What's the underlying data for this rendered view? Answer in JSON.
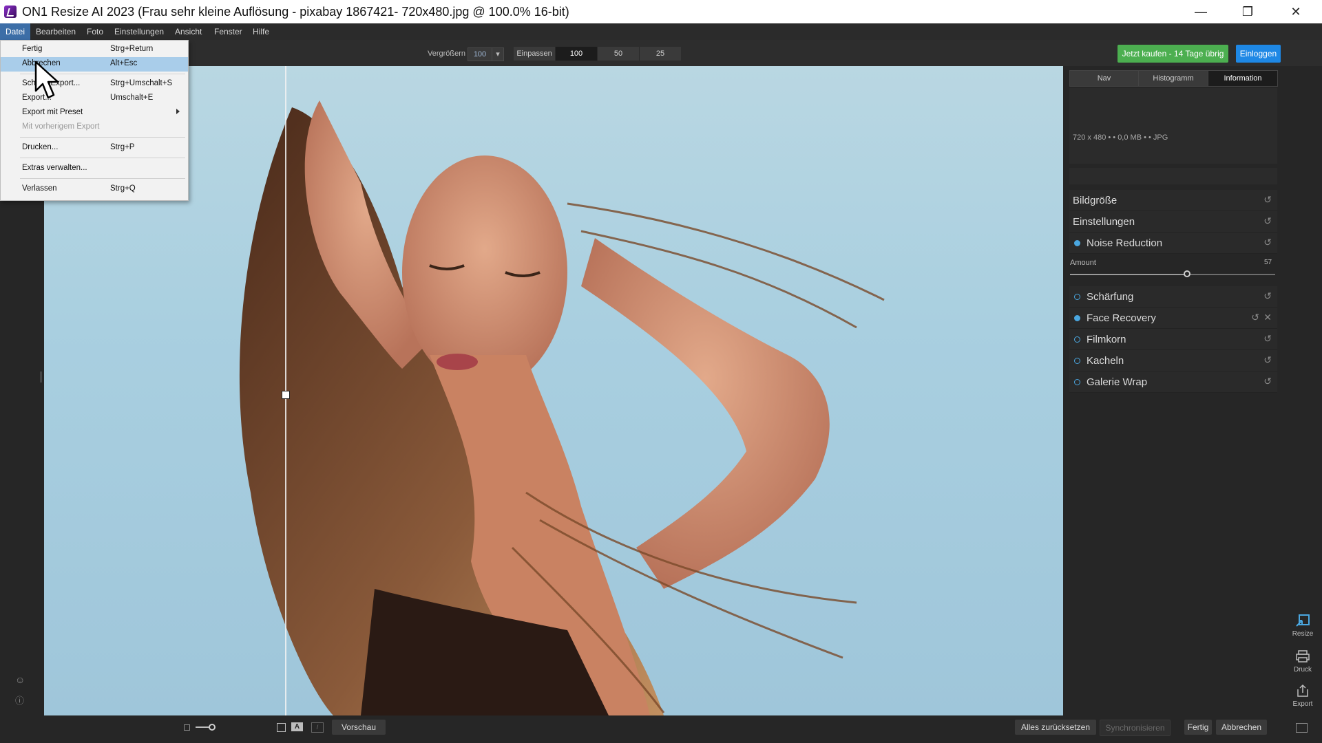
{
  "window": {
    "title": "ON1 Resize AI 2023 (Frau sehr kleine Auflösung - pixabay 1867421- 720x480.jpg @ 100.0% 16-bit)",
    "minimize_icon": "minimize-icon",
    "restore_icon": "restore-icon",
    "close_icon": "close-icon"
  },
  "menubar": {
    "items": [
      "Datei",
      "Bearbeiten",
      "Foto",
      "Einstellungen",
      "Ansicht",
      "Fenster",
      "Hilfe"
    ]
  },
  "file_menu": {
    "items": [
      {
        "label": "Fertig",
        "shortcut": "Strg+Return"
      },
      {
        "label": "Abbrechen",
        "shortcut": "Alt+Esc",
        "highlighted": true
      },
      {
        "label": "Schnell-Export...",
        "shortcut": "Strg+Umschalt+S"
      },
      {
        "label": "Export...",
        "shortcut": "Umschalt+E"
      },
      {
        "label": "Export mit Preset",
        "shortcut": "",
        "submenu": true
      },
      {
        "label": "Mit vorherigem Export",
        "shortcut": "",
        "disabled": true
      },
      {
        "label": "Drucken...",
        "shortcut": "Strg+P"
      },
      {
        "label": "Extras verwalten...",
        "shortcut": ""
      },
      {
        "label": "Verlassen",
        "shortcut": "Strg+Q"
      }
    ]
  },
  "toolbar": {
    "zoom_label": "Vergrößern",
    "zoom_value": "100",
    "fit_label": "Einpassen",
    "zoom_presets": [
      "100",
      "50",
      "25"
    ],
    "buy_button": "Jetzt kaufen - 14 Tage übrig",
    "login_button": "Einloggen",
    "colors": {
      "buy": "#4caf50",
      "login": "#1e88e5"
    }
  },
  "right_panel": {
    "tabs": [
      "Nav",
      "Histogramm",
      "Information"
    ],
    "active_tab": "Information",
    "info": "720 x 480 • • 0,0 MB • • JPG",
    "sections": [
      {
        "label": "Bildgröße",
        "dot": "none"
      },
      {
        "label": "Einstellungen",
        "dot": "none"
      },
      {
        "label": "Noise Reduction",
        "dot": "on"
      }
    ],
    "amount_label": "Amount",
    "amount_value": "57",
    "amount_fraction": 0.57,
    "sections2": [
      {
        "label": "Schärfung",
        "dot": "off"
      },
      {
        "label": "Face Recovery",
        "dot": "on",
        "closable": true
      },
      {
        "label": "Filmkorn",
        "dot": "off"
      },
      {
        "label": "Kacheln",
        "dot": "off"
      },
      {
        "label": "Galerie Wrap",
        "dot": "off"
      }
    ],
    "accent": "#4aa7e0"
  },
  "modules": [
    {
      "label": "Resize",
      "icon": "resize-icon"
    },
    {
      "label": "Druck",
      "icon": "print-icon"
    },
    {
      "label": "Export",
      "icon": "export-icon"
    }
  ],
  "bottombar": {
    "preview_button": "Vorschau",
    "reset_all": "Alles zurücksetzen",
    "sync": "Synchronisieren",
    "done": "Fertig",
    "cancel": "Abbrechen"
  }
}
